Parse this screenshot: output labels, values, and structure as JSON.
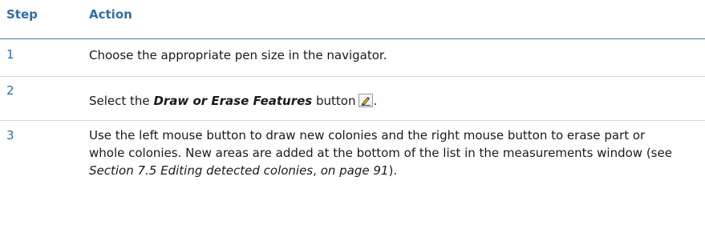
{
  "header": {
    "step": "Step",
    "action": "Action"
  },
  "rows": [
    {
      "step": "1",
      "text": "Choose the appropriate pen size in the navigator."
    },
    {
      "step": "2",
      "text_before": "Select the ",
      "emphasis": "Draw or Erase Features",
      "text_after": " button",
      "icon": "draw-erase-pen-icon",
      "trailing": "."
    },
    {
      "step": "3",
      "text_before": "Use the left mouse button to draw new colonies and the right mouse button to erase part or whole colonies. New areas are added at the bottom of the list in the measurements window (see ",
      "ref": "Section 7.5 Editing detected colonies",
      "text_mid": ", ",
      "ref_page": "on page 91",
      "text_after": ")."
    }
  ],
  "colors": {
    "accent": "#2f6ea4",
    "divider": "#c9d9e8",
    "header_rule": "#4a7aa8"
  }
}
